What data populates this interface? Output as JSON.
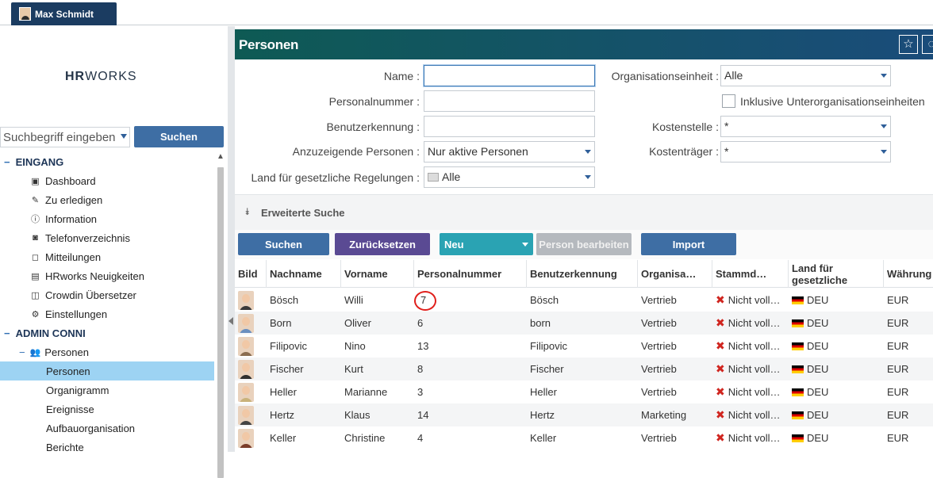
{
  "user": {
    "name": "Max Schmidt"
  },
  "sidebar": {
    "logo_bold": "HR",
    "logo_rest": "WORKS",
    "search_placeholder": "Suchbegriff eingeben",
    "search_button": "Suchen",
    "sections": [
      {
        "label": "EINGANG",
        "items": [
          "Dashboard",
          "Zu erledigen",
          "Information",
          "Telefonverzeichnis",
          "Mitteilungen",
          "HRworks Neuigkeiten",
          "Crowdin Übersetzer",
          "Einstellungen"
        ]
      },
      {
        "label": "ADMIN CONNI",
        "group": "Personen",
        "sub_items": [
          "Personen",
          "Organigramm",
          "Ereignisse",
          "Aufbauorganisation",
          "Berichte"
        ],
        "active": "Personen"
      }
    ]
  },
  "header": {
    "title": "Personen",
    "star_icon": "star-icon",
    "second_icon": "settings-icon"
  },
  "form": {
    "name_label": "Name :",
    "name_value": "",
    "personalnummer_label": "Personalnummer :",
    "personalnummer_value": "",
    "benutzerkennung_label": "Benutzerkennung :",
    "benutzerkennung_value": "",
    "anzuzeigende_label": "Anzuzeigende Personen :",
    "anzuzeigende_value": "Nur aktive Personen",
    "land_label": "Land für gesetzliche Regelungen :",
    "land_value": "Alle",
    "orgeinheit_label": "Organisationseinheit :",
    "orgeinheit_value": "Alle",
    "inklusive_label": "Inklusive Unterorganisationseinheiten",
    "kostenstelle_label": "Kostenstelle :",
    "kostenstelle_value": "*",
    "kostentraeger_label": "Kostenträger :",
    "kostentraeger_value": "*"
  },
  "advanced": {
    "label": "Erweiterte Suche"
  },
  "toolbar": {
    "search": "Suchen",
    "reset": "Zurücksetzen",
    "new": "Neu",
    "edit": "Person bearbeiten",
    "import": "Import",
    "colors": {
      "blue": "#3e6ea4",
      "purple": "#5a4a93",
      "teal": "#2aa3b3",
      "disabled": "#b5b9be"
    }
  },
  "table": {
    "columns": [
      "Bild",
      "Nachname",
      "Vorname",
      "Personalnummer",
      "Benutzerkennung",
      "Organisa…",
      "Stammd…",
      "Land für gesetzliche",
      "Währung"
    ],
    "rows": [
      {
        "nachname": "Bösch",
        "vorname": "Willi",
        "nummer": "7",
        "kennung": "Bösch",
        "org": "Vertrieb",
        "stamm": "Nicht voll…",
        "land": "DEU",
        "waehrung": "EUR",
        "shirt": "#3a3a3a"
      },
      {
        "nachname": "Born",
        "vorname": "Oliver",
        "nummer": "6",
        "kennung": "born",
        "org": "Vertrieb",
        "stamm": "Nicht voll…",
        "land": "DEU",
        "waehrung": "EUR",
        "shirt": "#6a8fbf"
      },
      {
        "nachname": "Filipovic",
        "vorname": "Nino",
        "nummer": "13",
        "kennung": "Filipovic",
        "org": "Vertrieb",
        "stamm": "Nicht voll…",
        "land": "DEU",
        "waehrung": "EUR",
        "shirt": "#8a6d50"
      },
      {
        "nachname": "Fischer",
        "vorname": "Kurt",
        "nummer": "8",
        "kennung": "Fischer",
        "org": "Vertrieb",
        "stamm": "Nicht voll…",
        "land": "DEU",
        "waehrung": "EUR",
        "shirt": "#2f2f2f"
      },
      {
        "nachname": "Heller",
        "vorname": "Marianne",
        "nummer": "3",
        "kennung": "Heller",
        "org": "Vertrieb",
        "stamm": "Nicht voll…",
        "land": "DEU",
        "waehrung": "EUR",
        "shirt": "#c9b27a"
      },
      {
        "nachname": "Hertz",
        "vorname": "Klaus",
        "nummer": "14",
        "kennung": "Hertz",
        "org": "Marketing",
        "stamm": "Nicht voll…",
        "land": "DEU",
        "waehrung": "EUR",
        "shirt": "#444"
      },
      {
        "nachname": "Keller",
        "vorname": "Christine",
        "nummer": "4",
        "kennung": "Keller",
        "org": "Vertrieb",
        "stamm": "Nicht voll…",
        "land": "DEU",
        "waehrung": "EUR",
        "shirt": "#7a3d2a"
      }
    ]
  }
}
